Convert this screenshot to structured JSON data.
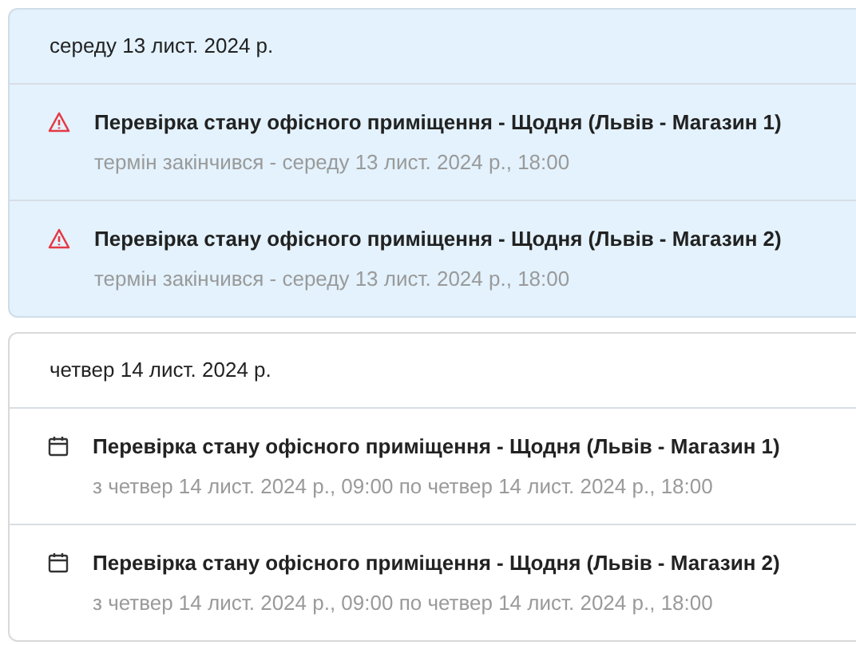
{
  "groups": [
    {
      "date": "середу 13 лист. 2024 р.",
      "highlighted": true,
      "items": [
        {
          "kind": "overdue",
          "title": "Перевірка стану офісного приміщення - Щодня (Львів - Магазин 1)",
          "subtitle": "термін закінчився - середу 13 лист. 2024 р., 18:00"
        },
        {
          "kind": "overdue",
          "title": "Перевірка стану офісного приміщення - Щодня (Львів - Магазин 2)",
          "subtitle": "термін закінчився - середу 13 лист. 2024 р., 18:00"
        }
      ]
    },
    {
      "date": "четвер 14 лист. 2024 р.",
      "highlighted": false,
      "items": [
        {
          "kind": "scheduled",
          "title": "Перевірка стану офісного приміщення - Щодня (Львів - Магазин 1)",
          "subtitle": "з четвер 14 лист. 2024 р., 09:00 по четвер 14 лист. 2024 р., 18:00"
        },
        {
          "kind": "scheduled",
          "title": "Перевірка стану офісного приміщення - Щодня (Львів - Магазин 2)",
          "subtitle": "з четвер 14 лист. 2024 р., 09:00 по четвер 14 лист. 2024 р., 18:00"
        }
      ]
    }
  ]
}
